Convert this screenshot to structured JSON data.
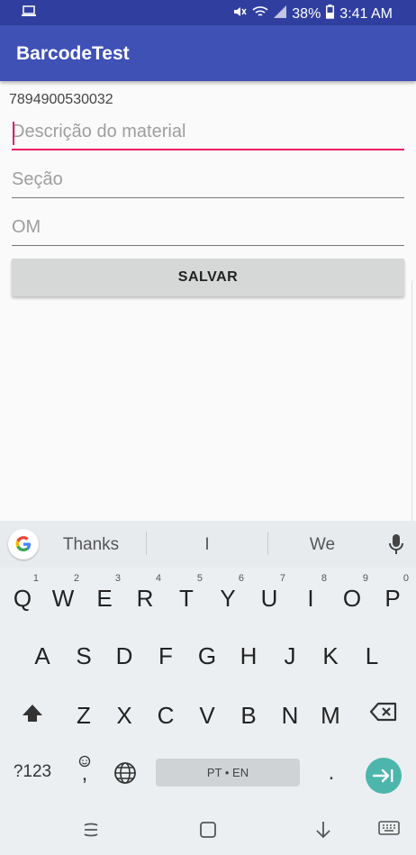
{
  "status_bar": {
    "battery": "38%",
    "time": "3:41 AM"
  },
  "app": {
    "title": "BarcodeTest"
  },
  "form": {
    "barcode": "7894900530032",
    "description_placeholder": "Descrição do material",
    "section_placeholder": "Seção",
    "om_placeholder": "OM",
    "save_label": "SALVAR"
  },
  "keyboard": {
    "suggestions": [
      "Thanks",
      "I",
      "We"
    ],
    "row1": [
      {
        "key": "Q",
        "num": "1"
      },
      {
        "key": "W",
        "num": "2"
      },
      {
        "key": "E",
        "num": "3"
      },
      {
        "key": "R",
        "num": "4"
      },
      {
        "key": "T",
        "num": "5"
      },
      {
        "key": "Y",
        "num": "6"
      },
      {
        "key": "U",
        "num": "7"
      },
      {
        "key": "I",
        "num": "8"
      },
      {
        "key": "O",
        "num": "9"
      },
      {
        "key": "P",
        "num": "0"
      }
    ],
    "row2": [
      "A",
      "S",
      "D",
      "F",
      "G",
      "H",
      "J",
      "K",
      "L"
    ],
    "row3": [
      "Z",
      "X",
      "C",
      "V",
      "B",
      "N",
      "M"
    ],
    "symbols_label": "?123",
    "emoji_comma": ",",
    "space_label": "PT • EN",
    "period": "."
  },
  "colors": {
    "status_bar": "#303f9f",
    "app_bar": "#3f51b5",
    "accent": "#e91e63",
    "enter": "#4db6ac"
  }
}
